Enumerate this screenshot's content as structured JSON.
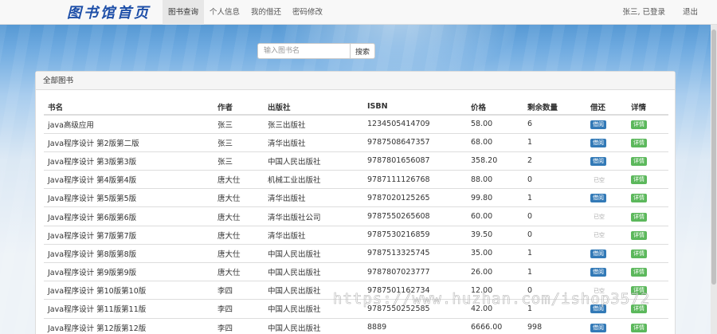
{
  "navbar": {
    "brand": "图书馆首页",
    "items": [
      {
        "label": "图书查询",
        "active": true
      },
      {
        "label": "个人信息"
      },
      {
        "label": "我的借还"
      },
      {
        "label": "密码修改"
      }
    ],
    "user_status": "张三, 已登录",
    "logout": "退出"
  },
  "search": {
    "placeholder": "输入图书名",
    "button": "搜索"
  },
  "panel": {
    "title": "全部图书",
    "columns": [
      "书名",
      "作者",
      "出版社",
      "ISBN",
      "价格",
      "剩余数量",
      "借还",
      "详情"
    ],
    "rows": [
      {
        "name": "java高级应用",
        "author": "张三",
        "publisher": "张三出版社",
        "isbn": "1234505414709",
        "price": "58.00",
        "stock": "6",
        "action": "借阅",
        "detail": "详情"
      },
      {
        "name": "Java程序设计 第2版第二版",
        "author": "张三",
        "publisher": "清华出版社",
        "isbn": "9787508647357",
        "price": "68.00",
        "stock": "1",
        "action": "借阅",
        "detail": "详情"
      },
      {
        "name": "Java程序设计 第3版第3版",
        "author": "张三",
        "publisher": "中国人民出版社",
        "isbn": "9787801656087",
        "price": "358.20",
        "stock": "2",
        "action": "借阅",
        "detail": "详情"
      },
      {
        "name": "Java程序设计 第4版第4版",
        "author": "唐大仕",
        "publisher": "机械工业出版社",
        "isbn": "9787111126768",
        "price": "88.00",
        "stock": "0",
        "action": "已空",
        "detail": "详情"
      },
      {
        "name": "Java程序设计 第5版第5版",
        "author": "唐大仕",
        "publisher": "清华出版社",
        "isbn": "9787020125265",
        "price": "99.80",
        "stock": "1",
        "action": "借阅",
        "detail": "详情"
      },
      {
        "name": "Java程序设计 第6版第6版",
        "author": "唐大仕",
        "publisher": "清华出版社公司",
        "isbn": "9787550265608",
        "price": "60.00",
        "stock": "0",
        "action": "已空",
        "detail": "详情"
      },
      {
        "name": "Java程序设计 第7版第7版",
        "author": "唐大仕",
        "publisher": "清华出版社",
        "isbn": "9787530216859",
        "price": "39.50",
        "stock": "0",
        "action": "已空",
        "detail": "详情"
      },
      {
        "name": "Java程序设计 第8版第8版",
        "author": "唐大仕",
        "publisher": "中国人民出版社",
        "isbn": "9787513325745",
        "price": "35.00",
        "stock": "1",
        "action": "借阅",
        "detail": "详情"
      },
      {
        "name": "Java程序设计 第9版第9版",
        "author": "唐大仕",
        "publisher": "中国人民出版社",
        "isbn": "9787807023777",
        "price": "26.00",
        "stock": "1",
        "action": "借阅",
        "detail": "详情"
      },
      {
        "name": "Java程序设计 第10版第10版",
        "author": "李四",
        "publisher": "中国人民出版社",
        "isbn": "9787501162734",
        "price": "12.00",
        "stock": "0",
        "action": "已空",
        "detail": "详情"
      },
      {
        "name": "Java程序设计 第11版第11版",
        "author": "李四",
        "publisher": "中国人民出版社",
        "isbn": "9787550252585",
        "price": "42.00",
        "stock": "1",
        "action": "借阅",
        "detail": "详情"
      },
      {
        "name": "Java程序设计 第12版第12版",
        "author": "李四",
        "publisher": "中国人民出版社",
        "isbn": "8889",
        "price": "6666.00",
        "stock": "998",
        "action": "借阅",
        "detail": "详情"
      }
    ]
  },
  "watermark": "https://www.huzhan.com/ishop3572"
}
